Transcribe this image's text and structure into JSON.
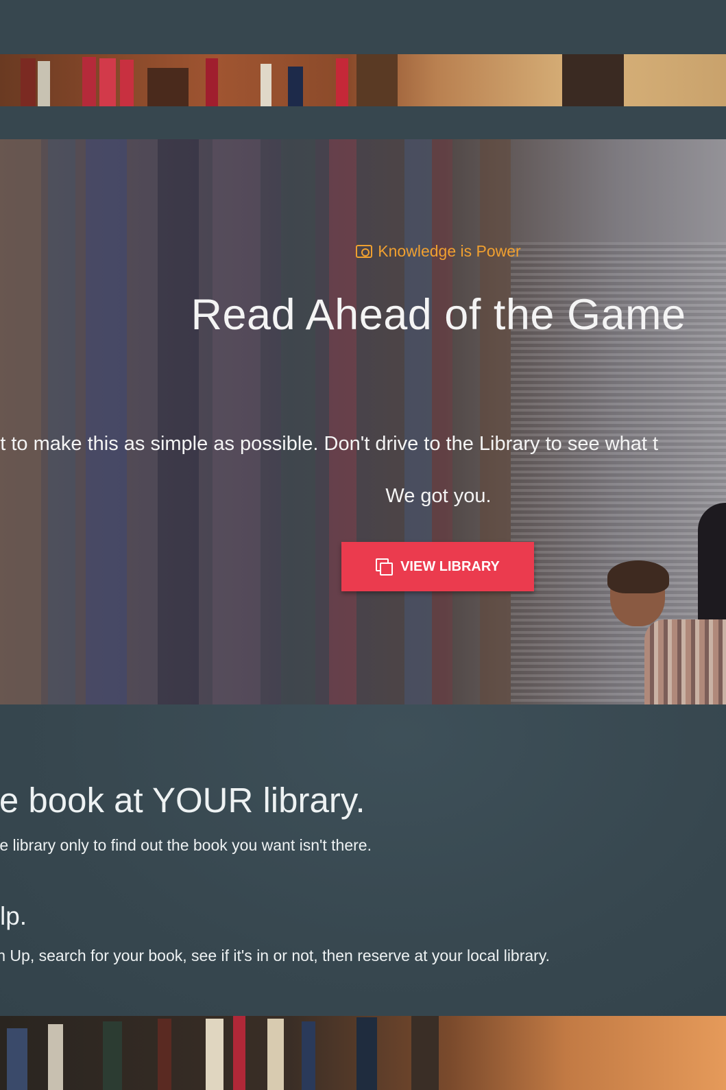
{
  "hero": {
    "tagline": "Knowledge is Power",
    "title": "Read Ahead of the Game",
    "body": "ant to make this as simple as possible. Don't drive to the Library to see what t",
    "subline": "We got you.",
    "button_label": "VIEW LIBRARY"
  },
  "info": {
    "heading_1": "favorite book at YOUR library.",
    "text_1": "ving to the library only to find out the book you want isn't there.",
    "heading_2": "o help.",
    "text_2": "Sign Up, search for your book, see if it's in or not, then reserve at your local library."
  },
  "colors": {
    "nav_bg": "#37474f",
    "accent_orange": "#f0a030",
    "button_red": "#eb3b4e",
    "text_light": "#f4f4f4"
  },
  "icons": {
    "tagline_icon": "camera-icon",
    "button_icon": "copy-icon"
  }
}
